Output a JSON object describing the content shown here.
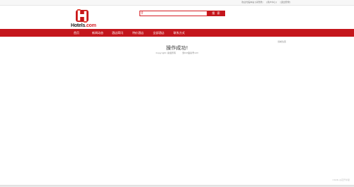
{
  "topbar": {
    "welcome": "欢迎光临本站 [请登录]",
    "user_center": "[用户中心]",
    "logout": "[退出登录]"
  },
  "brand": {
    "name_part1": "Hotels",
    "name_part2": ".com",
    "accent_color": "#c4161c"
  },
  "search": {
    "placeholder": "",
    "button_label": "搜 索"
  },
  "nav": {
    "items": [
      {
        "label": "首页"
      },
      {
        "label": "新闻动态"
      },
      {
        "label": "酒店简讯"
      },
      {
        "label": "特价酒店"
      },
      {
        "label": "全部酒店"
      },
      {
        "label": "联系方式"
      }
    ]
  },
  "breadcrumb": "当前位置",
  "main": {
    "message": "操作成功!",
    "copyright": "Copyright: 版权所有",
    "record": "浙ICP备案号123"
  },
  "watermark": "CSDN @花开半夏"
}
